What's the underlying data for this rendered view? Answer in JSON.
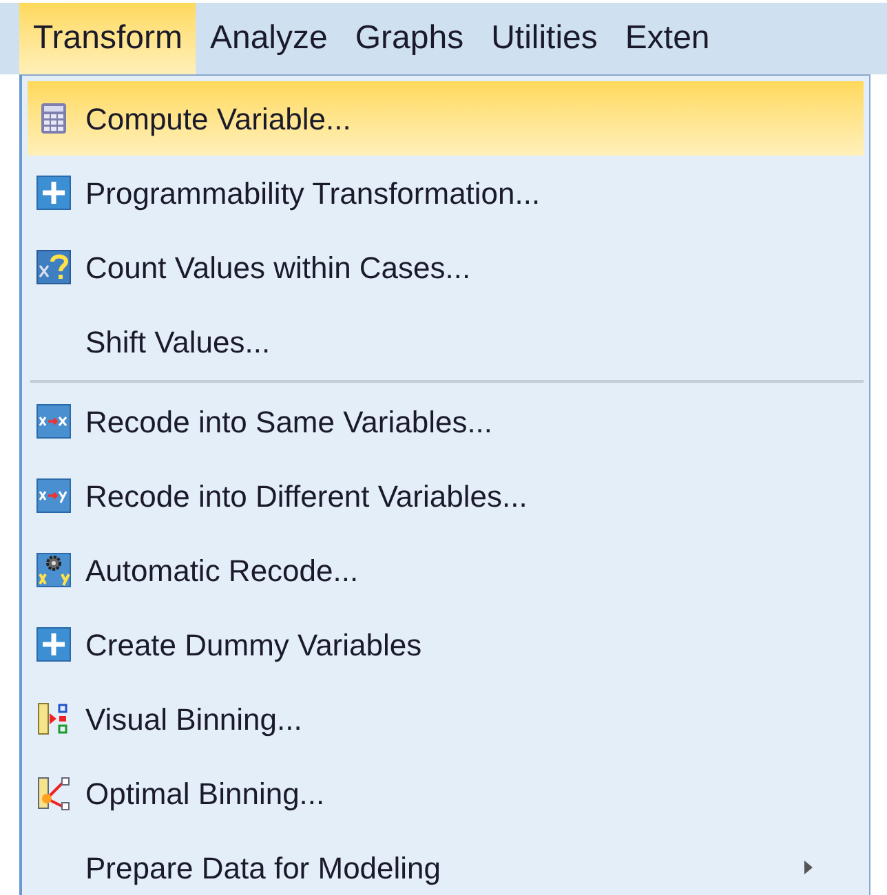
{
  "menubar": [
    {
      "label": "Transform",
      "selected": true
    },
    {
      "label": "Analyze",
      "selected": false
    },
    {
      "label": "Graphs",
      "selected": false
    },
    {
      "label": "Utilities",
      "selected": false
    },
    {
      "label": "Exten",
      "selected": false
    }
  ],
  "menu": [
    {
      "kind": "calculator",
      "label": "Compute Variable...",
      "selected": true,
      "submenu": false
    },
    {
      "kind": "plus",
      "label": "Programmability Transformation...",
      "selected": false,
      "submenu": false
    },
    {
      "kind": "count",
      "label": "Count Values within Cases...",
      "selected": false,
      "submenu": false
    },
    {
      "kind": "plain",
      "label": "Shift Values...",
      "selected": false,
      "submenu": false
    },
    {
      "kind": "separator"
    },
    {
      "kind": "recodesame",
      "label": "Recode into Same Variables...",
      "selected": false,
      "submenu": false
    },
    {
      "kind": "recodedifferent",
      "label": "Recode into Different Variables...",
      "selected": false,
      "submenu": false
    },
    {
      "kind": "autorecode",
      "label": "Automatic Recode...",
      "selected": false,
      "submenu": false
    },
    {
      "kind": "plus",
      "label": "Create Dummy Variables",
      "selected": false,
      "submenu": false
    },
    {
      "kind": "visualbinning",
      "label": "Visual Binning...",
      "selected": false,
      "submenu": false
    },
    {
      "kind": "optimalbinning",
      "label": "Optimal Binning...",
      "selected": false,
      "submenu": false
    },
    {
      "kind": "plain",
      "label": "Prepare Data for Modeling",
      "selected": false,
      "submenu": true
    }
  ]
}
